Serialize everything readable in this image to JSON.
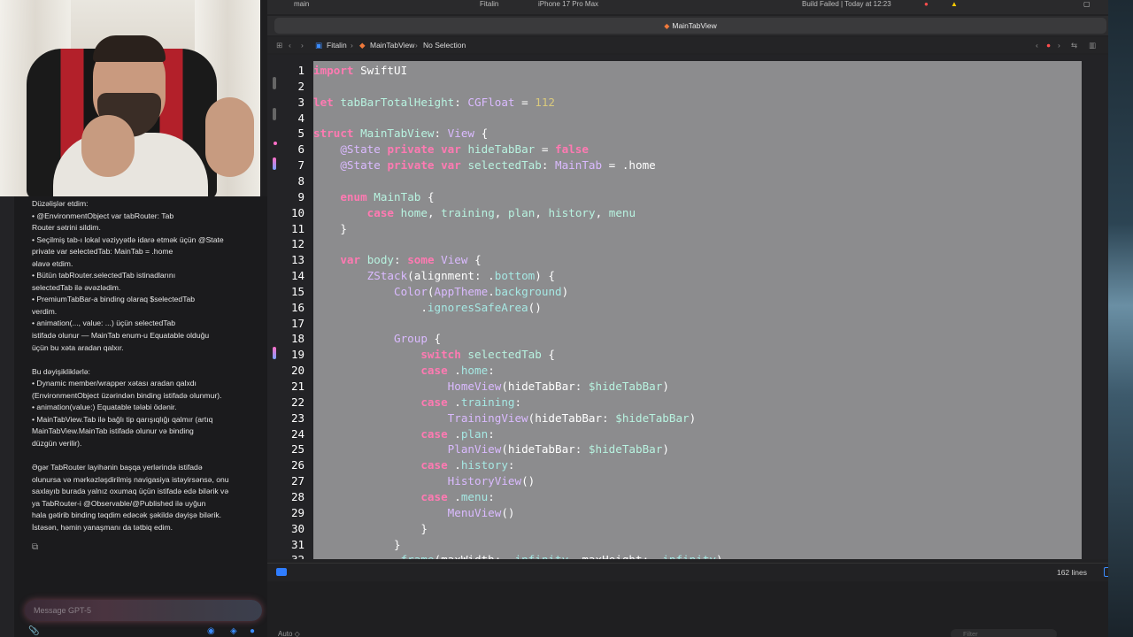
{
  "topbar": {
    "branch": "main",
    "scheme": "Fitalin",
    "device": "iPhone 17 Pro Max",
    "build_status": "Build Failed | Today at 12:23"
  },
  "tab": {
    "title": "MainTabView"
  },
  "jumpbar": {
    "project": "Fitalin",
    "file": "MainTabView",
    "selection": "No Selection"
  },
  "editor": {
    "line_count_label": "162 lines",
    "lines": [
      {
        "num": "1",
        "html": "<span class='k'>import</span> SwiftUI"
      },
      {
        "num": "2",
        "html": ""
      },
      {
        "num": "3",
        "html": "<span class='k'>let</span> <span class='f'>tabBarTotalHeight</span>: <span class='t'>CGFloat</span> = <span class='n'>112</span>"
      },
      {
        "num": "4",
        "html": ""
      },
      {
        "num": "5",
        "html": "<span class='k'>struct</span> <span class='f'>MainTabView</span>: <span class='t'>View</span> {"
      },
      {
        "num": "6",
        "html": "    <span class='t'>@State</span> <span class='k'>private var</span> <span class='f'>hideTabBar</span> = <span class='k'>false</span>"
      },
      {
        "num": "7",
        "html": "    <span class='t'>@State</span> <span class='k'>private var</span> <span class='f'>selectedTab</span>: <span class='t'>MainTab</span> = .home"
      },
      {
        "num": "8",
        "html": ""
      },
      {
        "num": "9",
        "html": "    <span class='k'>enum</span> <span class='f'>MainTab</span> {"
      },
      {
        "num": "10",
        "html": "        <span class='k'>case</span> <span class='f'>home</span>, <span class='f'>training</span>, <span class='f'>plan</span>, <span class='f'>history</span>, <span class='f'>menu</span>"
      },
      {
        "num": "11",
        "html": "    }"
      },
      {
        "num": "12",
        "html": ""
      },
      {
        "num": "13",
        "html": "    <span class='k'>var</span> <span class='f'>body</span>: <span class='k'>some</span> <span class='t'>View</span> {"
      },
      {
        "num": "14",
        "html": "        <span class='t'>ZStack</span>(alignment: .<span class='p'>bottom</span>) {"
      },
      {
        "num": "15",
        "html": "            <span class='t'>Color</span>(<span class='t'>AppTheme</span>.<span class='p'>background</span>)"
      },
      {
        "num": "16",
        "html": "                .<span class='p'>ignoresSafeArea</span>()"
      },
      {
        "num": "17",
        "html": ""
      },
      {
        "num": "18",
        "html": "            <span class='t'>Group</span> {"
      },
      {
        "num": "19",
        "html": "                <span class='k'>switch</span> <span class='f'>selectedTab</span> {"
      },
      {
        "num": "20",
        "html": "                <span class='k'>case</span> .<span class='p'>home</span>:"
      },
      {
        "num": "21",
        "html": "                    <span class='t'>HomeView</span>(hideTabBar: <span class='f'>$hideTabBar</span>)"
      },
      {
        "num": "22",
        "html": "                <span class='k'>case</span> .<span class='p'>training</span>:"
      },
      {
        "num": "23",
        "html": "                    <span class='t'>TrainingView</span>(hideTabBar: <span class='f'>$hideTabBar</span>)"
      },
      {
        "num": "24",
        "html": "                <span class='k'>case</span> .<span class='p'>plan</span>:"
      },
      {
        "num": "25",
        "html": "                    <span class='t'>PlanView</span>(hideTabBar: <span class='f'>$hideTabBar</span>)"
      },
      {
        "num": "26",
        "html": "                <span class='k'>case</span> .<span class='p'>history</span>:"
      },
      {
        "num": "27",
        "html": "                    <span class='t'>HistoryView</span>()"
      },
      {
        "num": "28",
        "html": "                <span class='k'>case</span> .<span class='p'>menu</span>:"
      },
      {
        "num": "29",
        "html": "                    <span class='t'>MenuView</span>()"
      },
      {
        "num": "30",
        "html": "                }"
      },
      {
        "num": "31",
        "html": "            }"
      },
      {
        "num": "32",
        "html": "            .<span class='p'>frame</span>(maxWidth: .<span class='p'>infinity</span>, maxHeight: .<span class='p'>infinity</span>)"
      }
    ]
  },
  "chat": {
    "lines": [
      "Düzəlişlər etdim:",
      "• @EnvironmentObject var tabRouter: Tab",
      "Router sətrini sildim.",
      "• Seçilmiş tab-ı lokal vəziyyətlə idarə etmək üçün @State",
      "private var selectedTab: MainTab = .home",
      "əlavə etdim.",
      "• Bütün tabRouter.selectedTab istinadlarını",
      "selectedTab ilə əvəzlədim.",
      "• PremiumTabBar-a binding olaraq $selectedTab",
      "verdim.",
      "• animation(..., value: ...) üçün selectedTab",
      "istifadə olunur — MainTab enum-u Equatable olduğu",
      "üçün bu xəta aradan qalxır.",
      "",
      "Bu dəyişikliklərlə:",
      "• Dynamic member/wrapper xətası aradan qalxdı",
      "(EnvironmentObject üzərindən binding istifadə olunmur).",
      "• animation(value:) Equatable tələbi ödənir.",
      "• MainTabView.Tab ilə bağlı tip qarışıqlığı qalmır (artıq",
      "MainTabView.MainTab istifadə olunur və binding",
      "düzgün verilir).",
      "",
      "Əgər TabRouter layihənin başqa yerlərində istifadə",
      "olunursa və mərkəzləşdirilmiş navigasiya istəyirsənsə, onu",
      "saxlayıb burada yalnız oxumaq üçün istifadə edə bilərik və",
      "ya TabRouter-i @Observable/@Published ilə uyğun",
      "hala gətirib binding təqdim edəcək şəkildə dəyişə bilərik.",
      "İstəsən, həmin yanaşmanı da tətbiq edim."
    ],
    "input_placeholder": "Message GPT-5"
  },
  "debug": {
    "mode": "Auto ◇",
    "filter_placeholder": "Filter"
  }
}
